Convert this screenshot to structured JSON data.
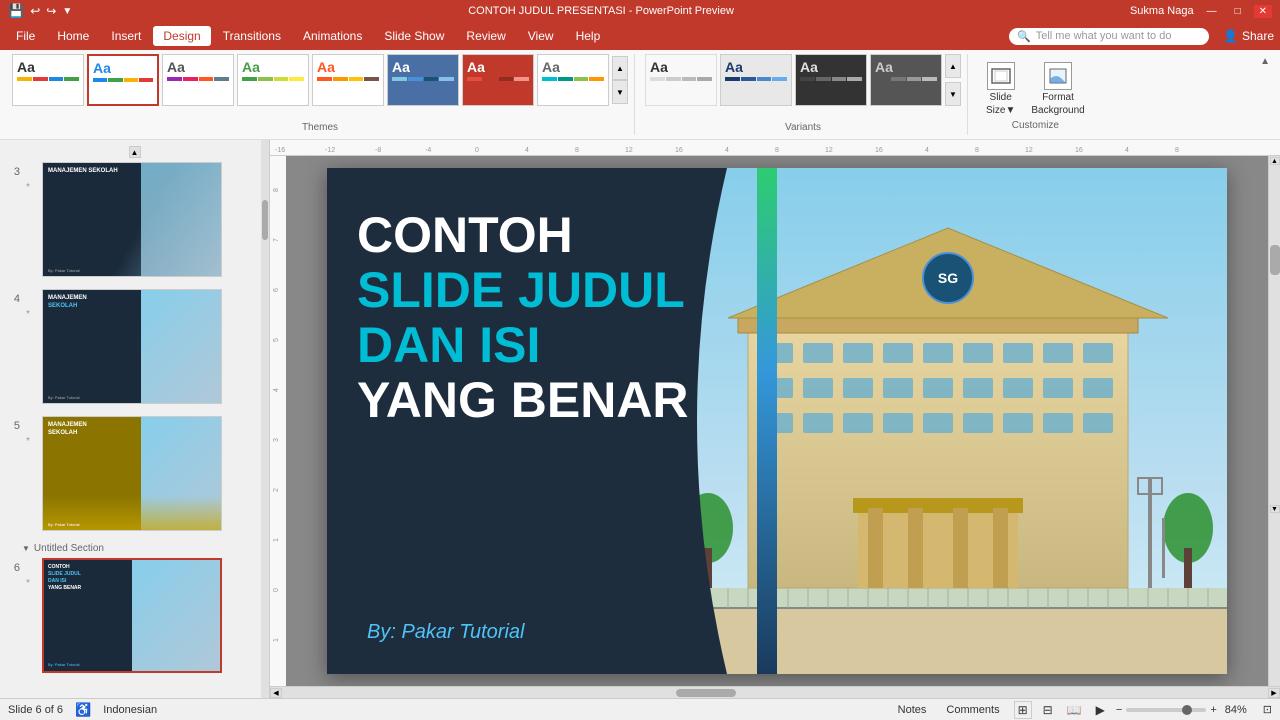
{
  "titlebar": {
    "title": "CONTOH JUDUL PRESENTASI - PowerPoint Preview",
    "user": "Sukma Naga",
    "minimize": "—",
    "restore": "□",
    "close": "✕"
  },
  "menubar": {
    "items": [
      "File",
      "Home",
      "Insert",
      "Design",
      "Transitions",
      "Animations",
      "Slide Show",
      "Review",
      "View",
      "Help"
    ],
    "active": "Design",
    "search_placeholder": "Tell me what you want to do",
    "share": "Share"
  },
  "ribbon": {
    "themes_label": "Themes",
    "variants_label": "Variants",
    "customize_label": "Customize",
    "slide_size": "Slide\nSize",
    "format_background": "Format\nBackground",
    "themes": [
      {
        "label": "Aa",
        "class": "t1"
      },
      {
        "label": "Aa",
        "class": "t2"
      },
      {
        "label": "Aa",
        "class": "t3"
      },
      {
        "label": "Aa",
        "class": "t4"
      },
      {
        "label": "Aa",
        "class": "t5"
      },
      {
        "label": "Aa",
        "class": "t6"
      },
      {
        "label": "Aa",
        "class": "t7"
      },
      {
        "label": "Aa",
        "class": "t8"
      }
    ],
    "variants": [
      {
        "class": "v1"
      },
      {
        "class": "v2"
      },
      {
        "class": "v3"
      },
      {
        "class": "v4"
      }
    ]
  },
  "slides": [
    {
      "num": "3",
      "star": "*",
      "title_line1": "MANAJEMEN SEKOLAH",
      "bg": "dark-blue"
    },
    {
      "num": "4",
      "star": "*",
      "title_line1": "MANAJEMEN",
      "title_line2": "SEKOLAH",
      "bg": "dark-blue"
    },
    {
      "num": "5",
      "star": "*",
      "title_line1": "MANAJEMEN",
      "title_line2": "SEKOLAH",
      "bg": "gold"
    },
    {
      "num": "6",
      "star": "*",
      "title_line1": "CONTOH",
      "title_line2": "SLIDE JUDUL",
      "title_line3": "DAN ISI",
      "title_line4": "YANG BENAR",
      "bg": "dark-blue",
      "active": true
    }
  ],
  "section": {
    "label": "Untitled Section"
  },
  "slide_content": {
    "line1": "CONTOH",
    "line2": "SLIDE JUDUL",
    "line3": "DAN ISI",
    "line4": "YANG BENAR",
    "byline": "By: Pakar Tutorial"
  },
  "statusbar": {
    "slide_info": "Slide 6 of 6",
    "language": "Indonesian",
    "notes": "Notes",
    "comments": "Comments",
    "zoom": "84%"
  }
}
